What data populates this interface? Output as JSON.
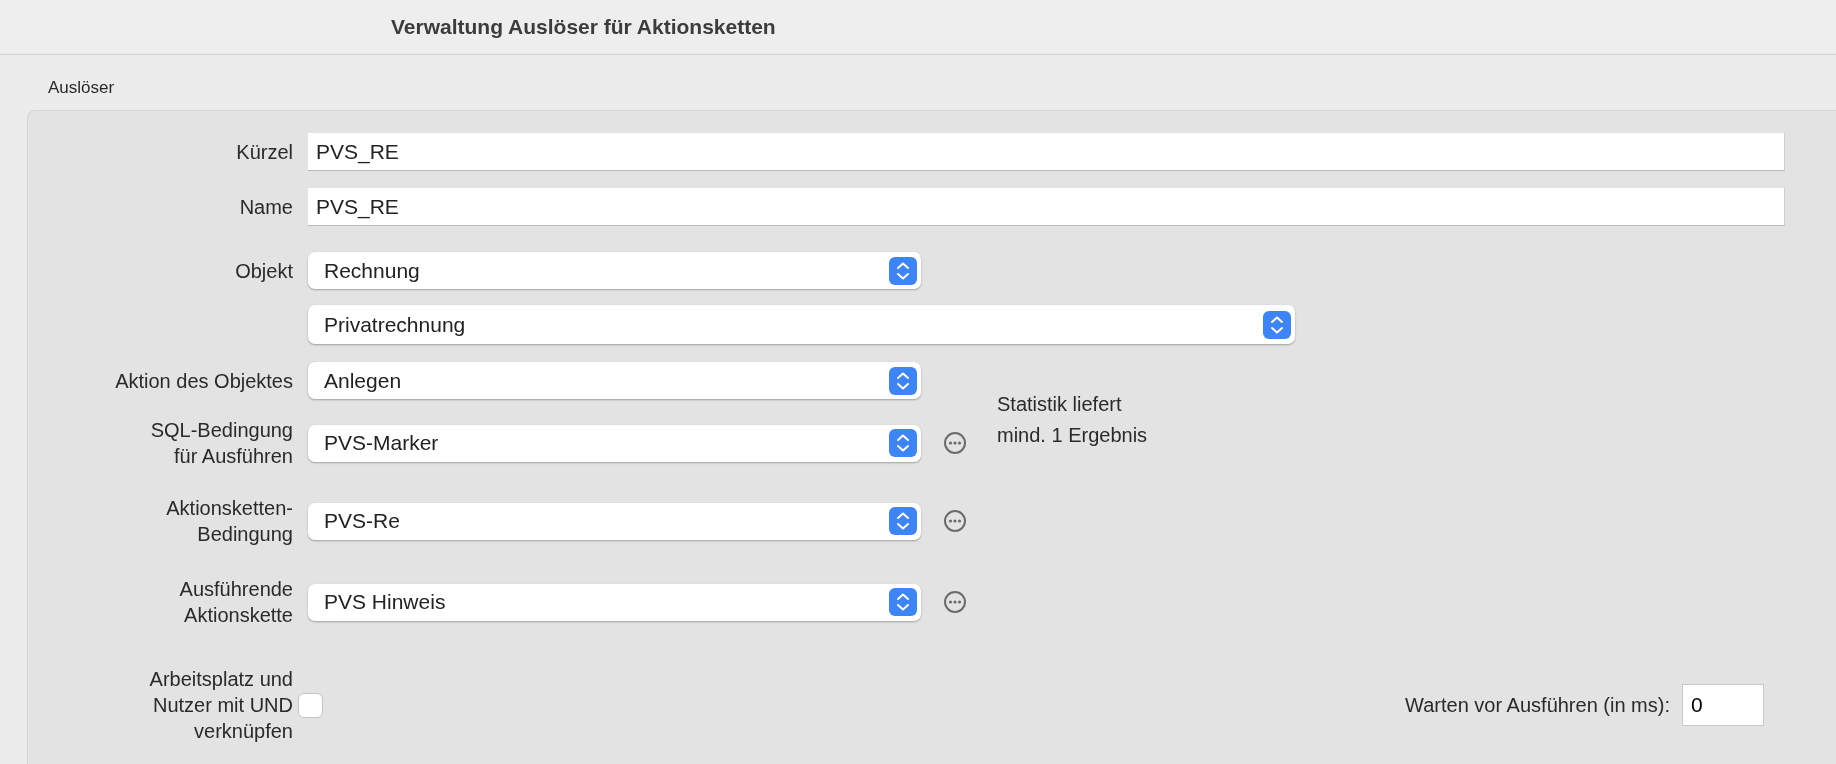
{
  "window": {
    "title": "Verwaltung Auslöser für Aktionsketten"
  },
  "group": {
    "title": "Auslöser"
  },
  "rows": [
    {
      "kind": "text",
      "label": "Kürzel",
      "value": "PVS_RE"
    },
    {
      "kind": "text",
      "label": "Name",
      "value": "PVS_RE"
    },
    {
      "kind": "popup",
      "label": "Objekt",
      "value": "Rechnung",
      "more_button": false
    },
    {
      "kind": "wide_popup",
      "value": "Privatrechnung",
      "more_button": false
    },
    {
      "kind": "popup",
      "label": "Aktion des Objektes",
      "value": "Anlegen",
      "more_button": false
    },
    {
      "kind": "popup",
      "label": "SQL-Bedingung\nfür Ausführen",
      "value": "PVS-Marker",
      "more_button": true,
      "note": "Statistik liefert\nmind. 1 Ergebnis"
    },
    {
      "kind": "popup",
      "label": "Aktionsketten-\nBedingung",
      "value": "PVS-Re",
      "more_button": true
    },
    {
      "kind": "popup",
      "label": "Ausführende\nAktionskette",
      "value": "PVS Hinweis",
      "more_button": true
    }
  ],
  "link_option": {
    "label": "Arbeitsplatz und\nNutzer mit UND\nverknüpfen",
    "checked": false
  },
  "delay": {
    "label": "Warten vor Ausführen (in ms):",
    "value": "0"
  }
}
